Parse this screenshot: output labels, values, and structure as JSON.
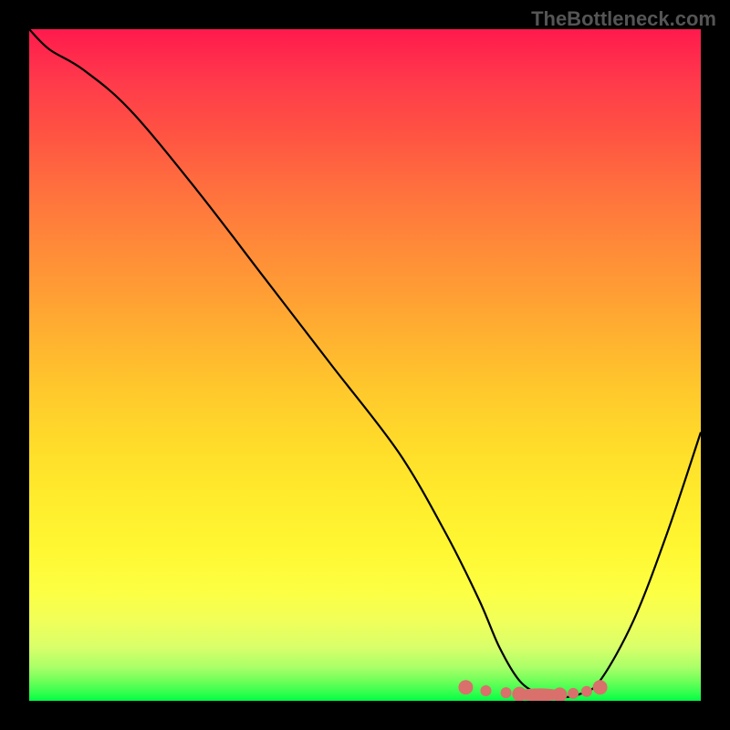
{
  "watermark": "TheBottleneck.com",
  "chart_data": {
    "type": "line",
    "title": "",
    "xlabel": "",
    "ylabel": "",
    "xlim": [
      0,
      100
    ],
    "ylim": [
      0,
      100
    ],
    "series": [
      {
        "name": "curve",
        "x": [
          0,
          3,
          8,
          15,
          25,
          35,
          45,
          55,
          62,
          67,
          70,
          73,
          76,
          79,
          82,
          85,
          90,
          95,
          100
        ],
        "y": [
          100,
          97,
          94,
          88,
          76,
          63,
          50,
          37,
          25,
          15,
          8,
          3,
          1,
          0.5,
          1,
          3,
          12,
          25,
          40
        ],
        "color": "#000000"
      },
      {
        "name": "markers",
        "type": "scatter",
        "x": [
          65,
          68,
          71,
          73,
          75,
          77,
          79,
          81,
          83,
          85
        ],
        "y": [
          2,
          1.5,
          1.2,
          1,
          0.8,
          0.8,
          0.9,
          1.1,
          1.4,
          2
        ],
        "color": "#d9706b"
      }
    ],
    "background": "rainbow-gradient-vertical"
  }
}
